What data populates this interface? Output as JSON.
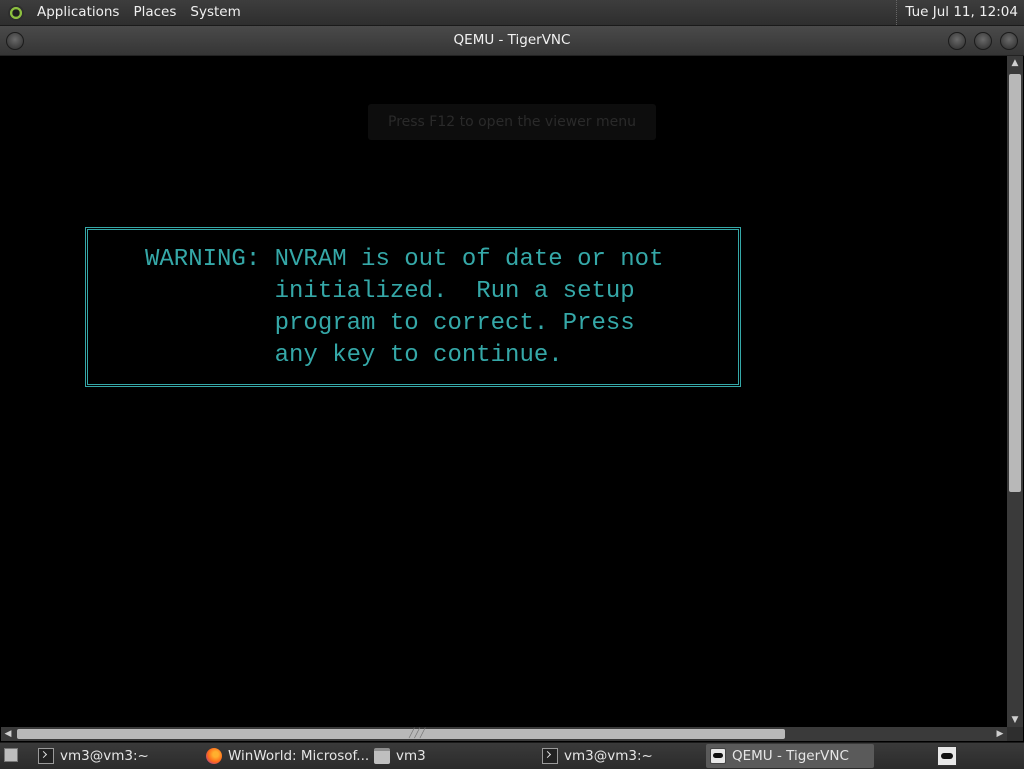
{
  "top_panel": {
    "menus": [
      "Applications",
      "Places",
      "System"
    ],
    "clock": "Tue Jul 11, 12:04"
  },
  "window": {
    "title": "QEMU - TigerVNC"
  },
  "remote_screen": {
    "hint": "Press F12 to open the viewer menu",
    "warning_lines": [
      "WARNING: NVRAM is out of date or not",
      "         initialized.  Run a setup",
      "         program to correct. Press",
      "         any key to continue."
    ],
    "text_color": "#35a8a8"
  },
  "taskbar": {
    "tasks": [
      {
        "label": "vm3@vm3:~",
        "icon": "terminal-icon"
      },
      {
        "label": "WinWorld: Microsof...",
        "icon": "firefox-icon"
      },
      {
        "label": "vm3",
        "icon": "folder-icon"
      },
      {
        "label": "vm3@vm3:~",
        "icon": "terminal-icon"
      },
      {
        "label": "QEMU - TigerVNC",
        "icon": "vnc-icon",
        "active": true
      }
    ]
  }
}
